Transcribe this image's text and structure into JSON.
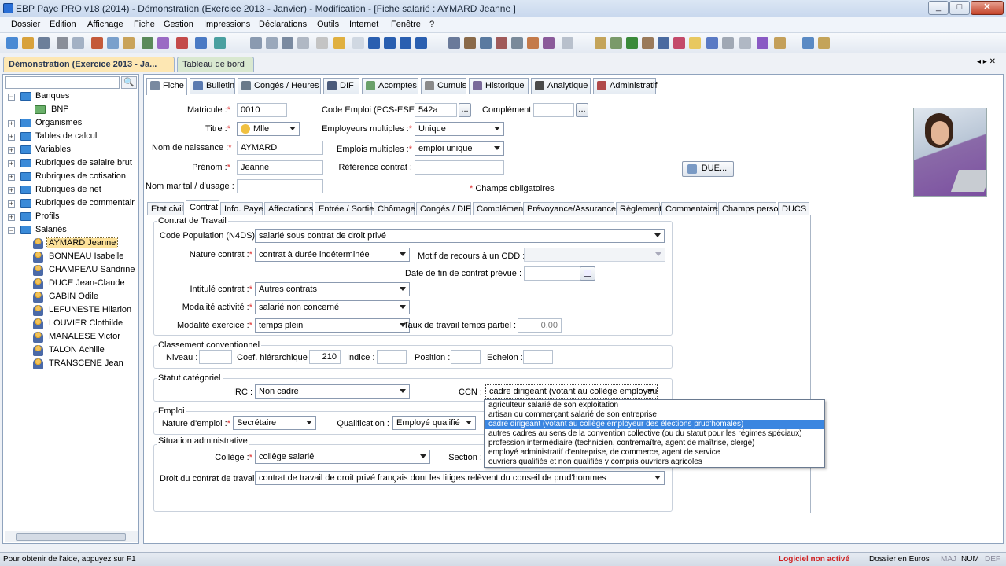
{
  "window": {
    "title": "EBP Paye PRO v18 (2014) - Démonstration (Exercice 2013 - Janvier) - Modification - [Fiche salarié : AYMARD Jeanne ]"
  },
  "menu": [
    "Dossier",
    "Edition",
    "Affichage",
    "Fiche",
    "Gestion",
    "Impressions",
    "Déclarations",
    "Outils",
    "Internet",
    "Fenêtre",
    "?"
  ],
  "doc_tabs": {
    "active": "Démonstration (Exercice 2013 - Ja...",
    "second": "Tableau de bord"
  },
  "tree": {
    "folders": [
      "Banques",
      "Organismes",
      "Tables de calcul",
      "Variables",
      "Rubriques de salaire brut",
      "Rubriques de cotisation",
      "Rubriques de net",
      "Rubriques de commentair",
      "Profils",
      "Salariés"
    ],
    "bank": "BNP",
    "employees": [
      "AYMARD Jeanne",
      "BONNEAU Isabelle",
      "CHAMPEAU Sandrine",
      "DUCE Jean-Claude",
      "GABIN Odile",
      "LEFUNESTE Hilarion",
      "LOUVIER Clothilde",
      "MANALESE Victor",
      "TALON Achille",
      "TRANSCENE Jean"
    ],
    "expander_plus": "+",
    "expander_minus": "−"
  },
  "main_tabs": [
    "Fiche",
    "Bulletin",
    "Congés / Heures",
    "DIF",
    "Acomptes",
    "Cumuls",
    "Historique",
    "Analytique",
    "Administratif"
  ],
  "fiche": {
    "matricule_label": "Matricule :",
    "matricule": "0010",
    "code_emploi_label": "Code Emploi (PCS-ESE) :",
    "code_emploi": "542a",
    "complement_label": "Complément :",
    "complement": "",
    "titre_label": "Titre :",
    "titre": "Mlle",
    "employeurs_label": "Employeurs multiples :",
    "employeurs": "Unique",
    "nom_naissance_label": "Nom de naissance :",
    "nom_naissance": "AYMARD",
    "emplois_label": "Emplois multiples :",
    "emplois": "emploi unique",
    "prenom_label": "Prénom :",
    "prenom": "Jeanne",
    "ref_contrat_label": "Référence contrat :",
    "ref_contrat": "",
    "nom_marital_label": "Nom marital / d'usage :",
    "nom_marital": "",
    "champs_obligatoires": "Champs obligatoires",
    "due_button": "DUE...",
    "ellipsis": "...",
    "required_mark": "*"
  },
  "sub_tabs": [
    "Etat civil",
    "Contrat",
    "Info. Paye",
    "Affectations",
    "Entrée / Sortie",
    "Chômage",
    "Congés / DIF",
    "Complément",
    "Prévoyance/Assurance",
    "Règlement",
    "Commentaires",
    "Champs perso.",
    "DUCS"
  ],
  "contrat": {
    "group_contrat": "Contrat de Travail",
    "code_population_label": "Code Population (N4DS) :",
    "code_population": "salarié sous contrat de droit privé",
    "nature_contrat_label": "Nature contrat :",
    "nature_contrat": "contrat à durée indéterminée",
    "motif_label": "Motif de recours à un CDD :",
    "motif": "",
    "date_fin_label": "Date de fin de contrat prévue :",
    "date_fin": "",
    "intitule_label": "Intitulé contrat :",
    "intitule": "Autres contrats",
    "modalite_activite_label": "Modalité activité :",
    "modalite_activite": "salarié non concerné",
    "modalite_exercice_label": "Modalité exercice :",
    "modalite_exercice": "temps plein",
    "taux_label": "Taux de travail temps partiel :",
    "taux": "0,00",
    "group_classement": "Classement conventionnel",
    "niveau_label": "Niveau :",
    "niveau": "",
    "coef_label": "Coef. hiérarchique :",
    "coef": "210",
    "indice_label": "Indice :",
    "indice": "",
    "position_label": "Position :",
    "position": "",
    "echelon_label": "Echelon :",
    "echelon": "",
    "group_statut": "Statut catégoriel",
    "irc_label": "IRC :",
    "irc": "Non cadre",
    "ccn_label": "CCN :",
    "ccn": "cadre dirigeant (votant au collège employeur",
    "group_emploi": "Emploi",
    "nature_emploi_label": "Nature d'emploi :",
    "nature_emploi": "Secrétaire",
    "qualification_label": "Qualification :",
    "qualification": "Employé qualifié",
    "group_situation": "Situation administrative",
    "college_label": "Collège :",
    "college": "collège salarié",
    "section_label": "Section :",
    "droit_label": "Droit du contrat de travail :",
    "droit": "contrat de travail de droit privé français dont les litiges relèvent du conseil de prud'hommes"
  },
  "ccn_options": [
    "agriculteur salarié de son exploitation",
    "artisan ou commerçant salarié de son entreprise",
    "cadre dirigeant (votant au collège employeur des élections prud'homales)",
    "autres cadres au sens de la convention collective (ou du statut pour les régimes spéciaux)",
    "profession intermédiaire (technicien, contremaître, agent de maîtrise, clergé)",
    "employé administratif d'entreprise, de commerce, agent de service",
    "ouvriers qualifiés et non qualifiés y compris ouvriers agricoles"
  ],
  "ccn_selected_index": 2,
  "statusbar": {
    "help": "Pour obtenir de l'aide, appuyez sur F1",
    "logiciel": "Logiciel non activé",
    "dossier": "Dossier en Euros",
    "maj": "MAJ",
    "num": "NUM",
    "def": "DEF"
  },
  "colors": {
    "accent_tab": "#fde7b3",
    "selected_option": "#3b86e0",
    "warning": "#d02020"
  }
}
